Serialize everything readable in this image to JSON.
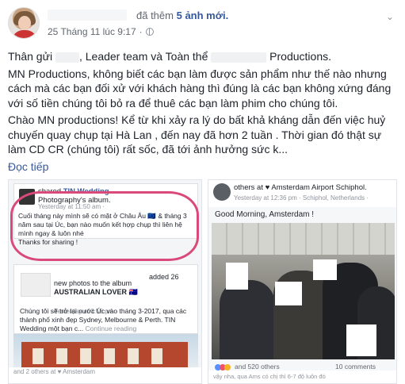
{
  "post": {
    "action_prefix": "đã thêm",
    "action_link": "5 ảnh mới.",
    "timestamp": "25 Tháng 11 lúc 9:17",
    "meta_separator": "·",
    "greeting_prefix": "Thân gửi",
    "greeting_mid": ", Leader team và Toàn thể",
    "greeting_suffix": "Productions.",
    "paragraph1": "MN Productions, không biết các bạn làm được sản phẩm như thế nào nhưng cách mà các bạn đối xử với khách hàng thì đúng là các bạn không xứng đáng với số tiền chúng tôi bỏ ra để thuê các bạn làm phim cho chúng tôi.",
    "paragraph2": "Chào MN productions! Kể từ khi xảy ra lý do bất khả kháng dẫn đến việc huỷ chuyến quay chụp tại Hà Lan , đến nay đã hơn 2 tuần . Thời gian đó thật sự làm CD CR (chúng tôi) rất sốc, đã tới ảnh hưởng sức k...",
    "see_more": "Đọc tiếp"
  },
  "image_left": {
    "shared_prefix": "shared",
    "shared_name": "TIN Wedding",
    "shared_suffix": "Photography's album.",
    "time": "Yesterday at 11:50 am ·",
    "body": "Cuối tháng này mình sẽ có mặt ở Châu Âu 🇪🇺 & tháng 3 năm sau tại Úc, bạn nào muốn kết hợp chụp thì liên hệ mình ngay & luôn nhé\nThanks for sharing !",
    "added": "added 26",
    "album_prefix": "new photos to the album",
    "album_title": "AUSTRALIAN LOVER 🇦🇺",
    "album_time": "Yesterday at 3:56 pm ·",
    "album_body": "Chúng tôi sẽ trở lại nước Úc vào tháng 3-2017, qua các thành phố xinh đẹp Sydney, Melbourne & Perth. TIN Wedding một bạn c...",
    "album_more": "Continue reading",
    "footer": "and 2 others at ♥ Amsterdam"
  },
  "image_right": {
    "title": "others at ♥ Amsterdam Airport Schiphol.",
    "time": "Yesterday at 12:36 pm · Schiphol, Netherlands ·",
    "greeting": "Good Morning, Amsterdam !",
    "likes": "and 520 others",
    "comments": "10 comments",
    "footer": "vậy nha, qua Ams có chị thì 6-7 độ luôn đó"
  },
  "colors": {
    "link": "#365899",
    "text": "#1d2129",
    "muted": "#616770",
    "circle": "#d94a7a"
  }
}
